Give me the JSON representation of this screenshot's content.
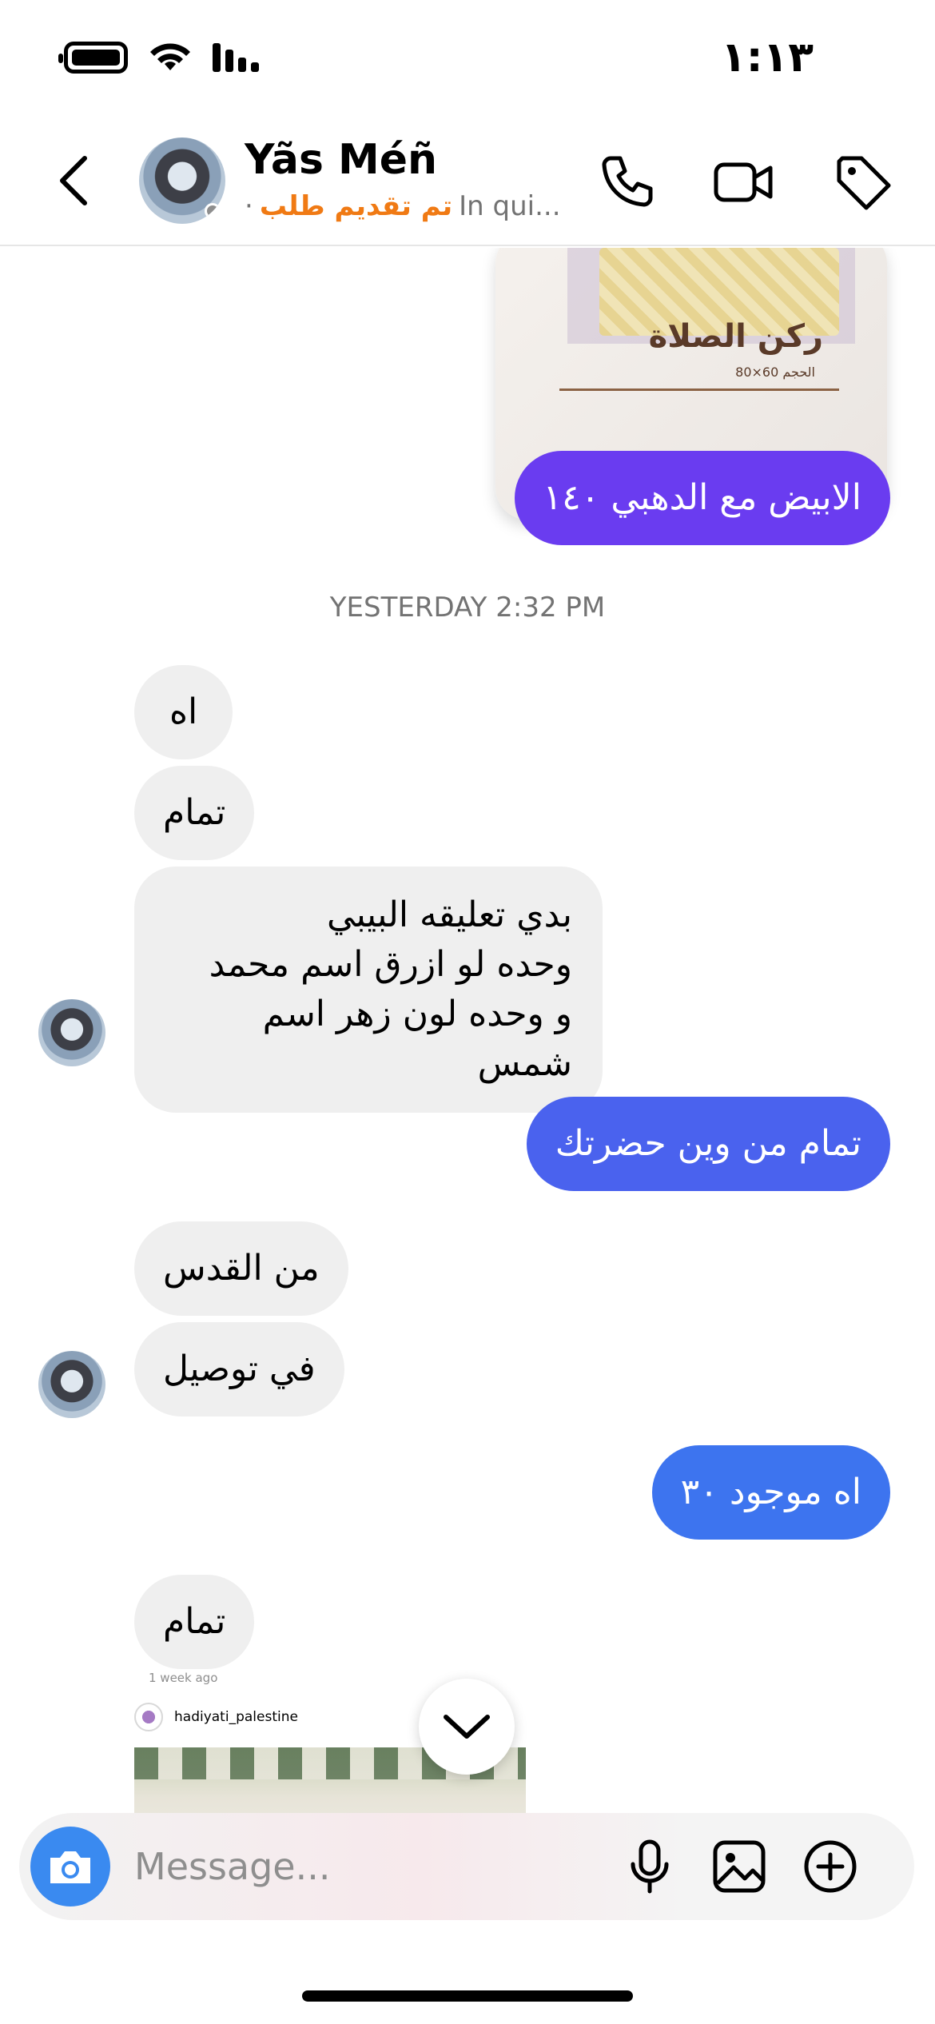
{
  "status_bar": {
    "time": "١:١٣",
    "icons": [
      "battery-icon",
      "wifi-icon",
      "signal-icon"
    ]
  },
  "header": {
    "name": "Yãs Méñ",
    "subtitle_orange": "تم تقديم طلب",
    "subtitle_gray": "In qui...",
    "separator": "·",
    "icons": [
      "back-chevron-icon",
      "phone-icon",
      "video-camera-icon",
      "tag-icon"
    ]
  },
  "product_card": {
    "title": "ركن الصلاة",
    "size_text": "الحجم 60×80"
  },
  "messages": {
    "m1": "الابيض مع الدهبي ١٤٠",
    "timestamp": "YESTERDAY 2:32 PM",
    "m2": "اه",
    "m3": "تمام",
    "m4_lines": [
      "بدي  تعليقه البيبي",
      "وحده لو ازرق اسم محمد",
      "و وحده لون زهر اسم شمس"
    ],
    "m5": "تمام من وين حضرتك",
    "m6": "من القدس",
    "m7": "في توصيل",
    "m8": "اه موجود ٣٠",
    "m9": "تمام",
    "m9_ago": "1 week ago"
  },
  "shared_post": {
    "username": "hadiyati_palestine"
  },
  "composer": {
    "placeholder": "Message...",
    "icons": [
      "camera-icon",
      "microphone-icon",
      "gallery-icon",
      "plus-circle-icon"
    ]
  },
  "colors": {
    "bubble_out_purple": "#6a3cf0",
    "bubble_out_blue": "#4a62ee",
    "bubble_out_light": "#3d74ef",
    "bubble_in": "#efefef",
    "accent_orange": "#f07a14",
    "camera_blue": "#3a8af0"
  }
}
